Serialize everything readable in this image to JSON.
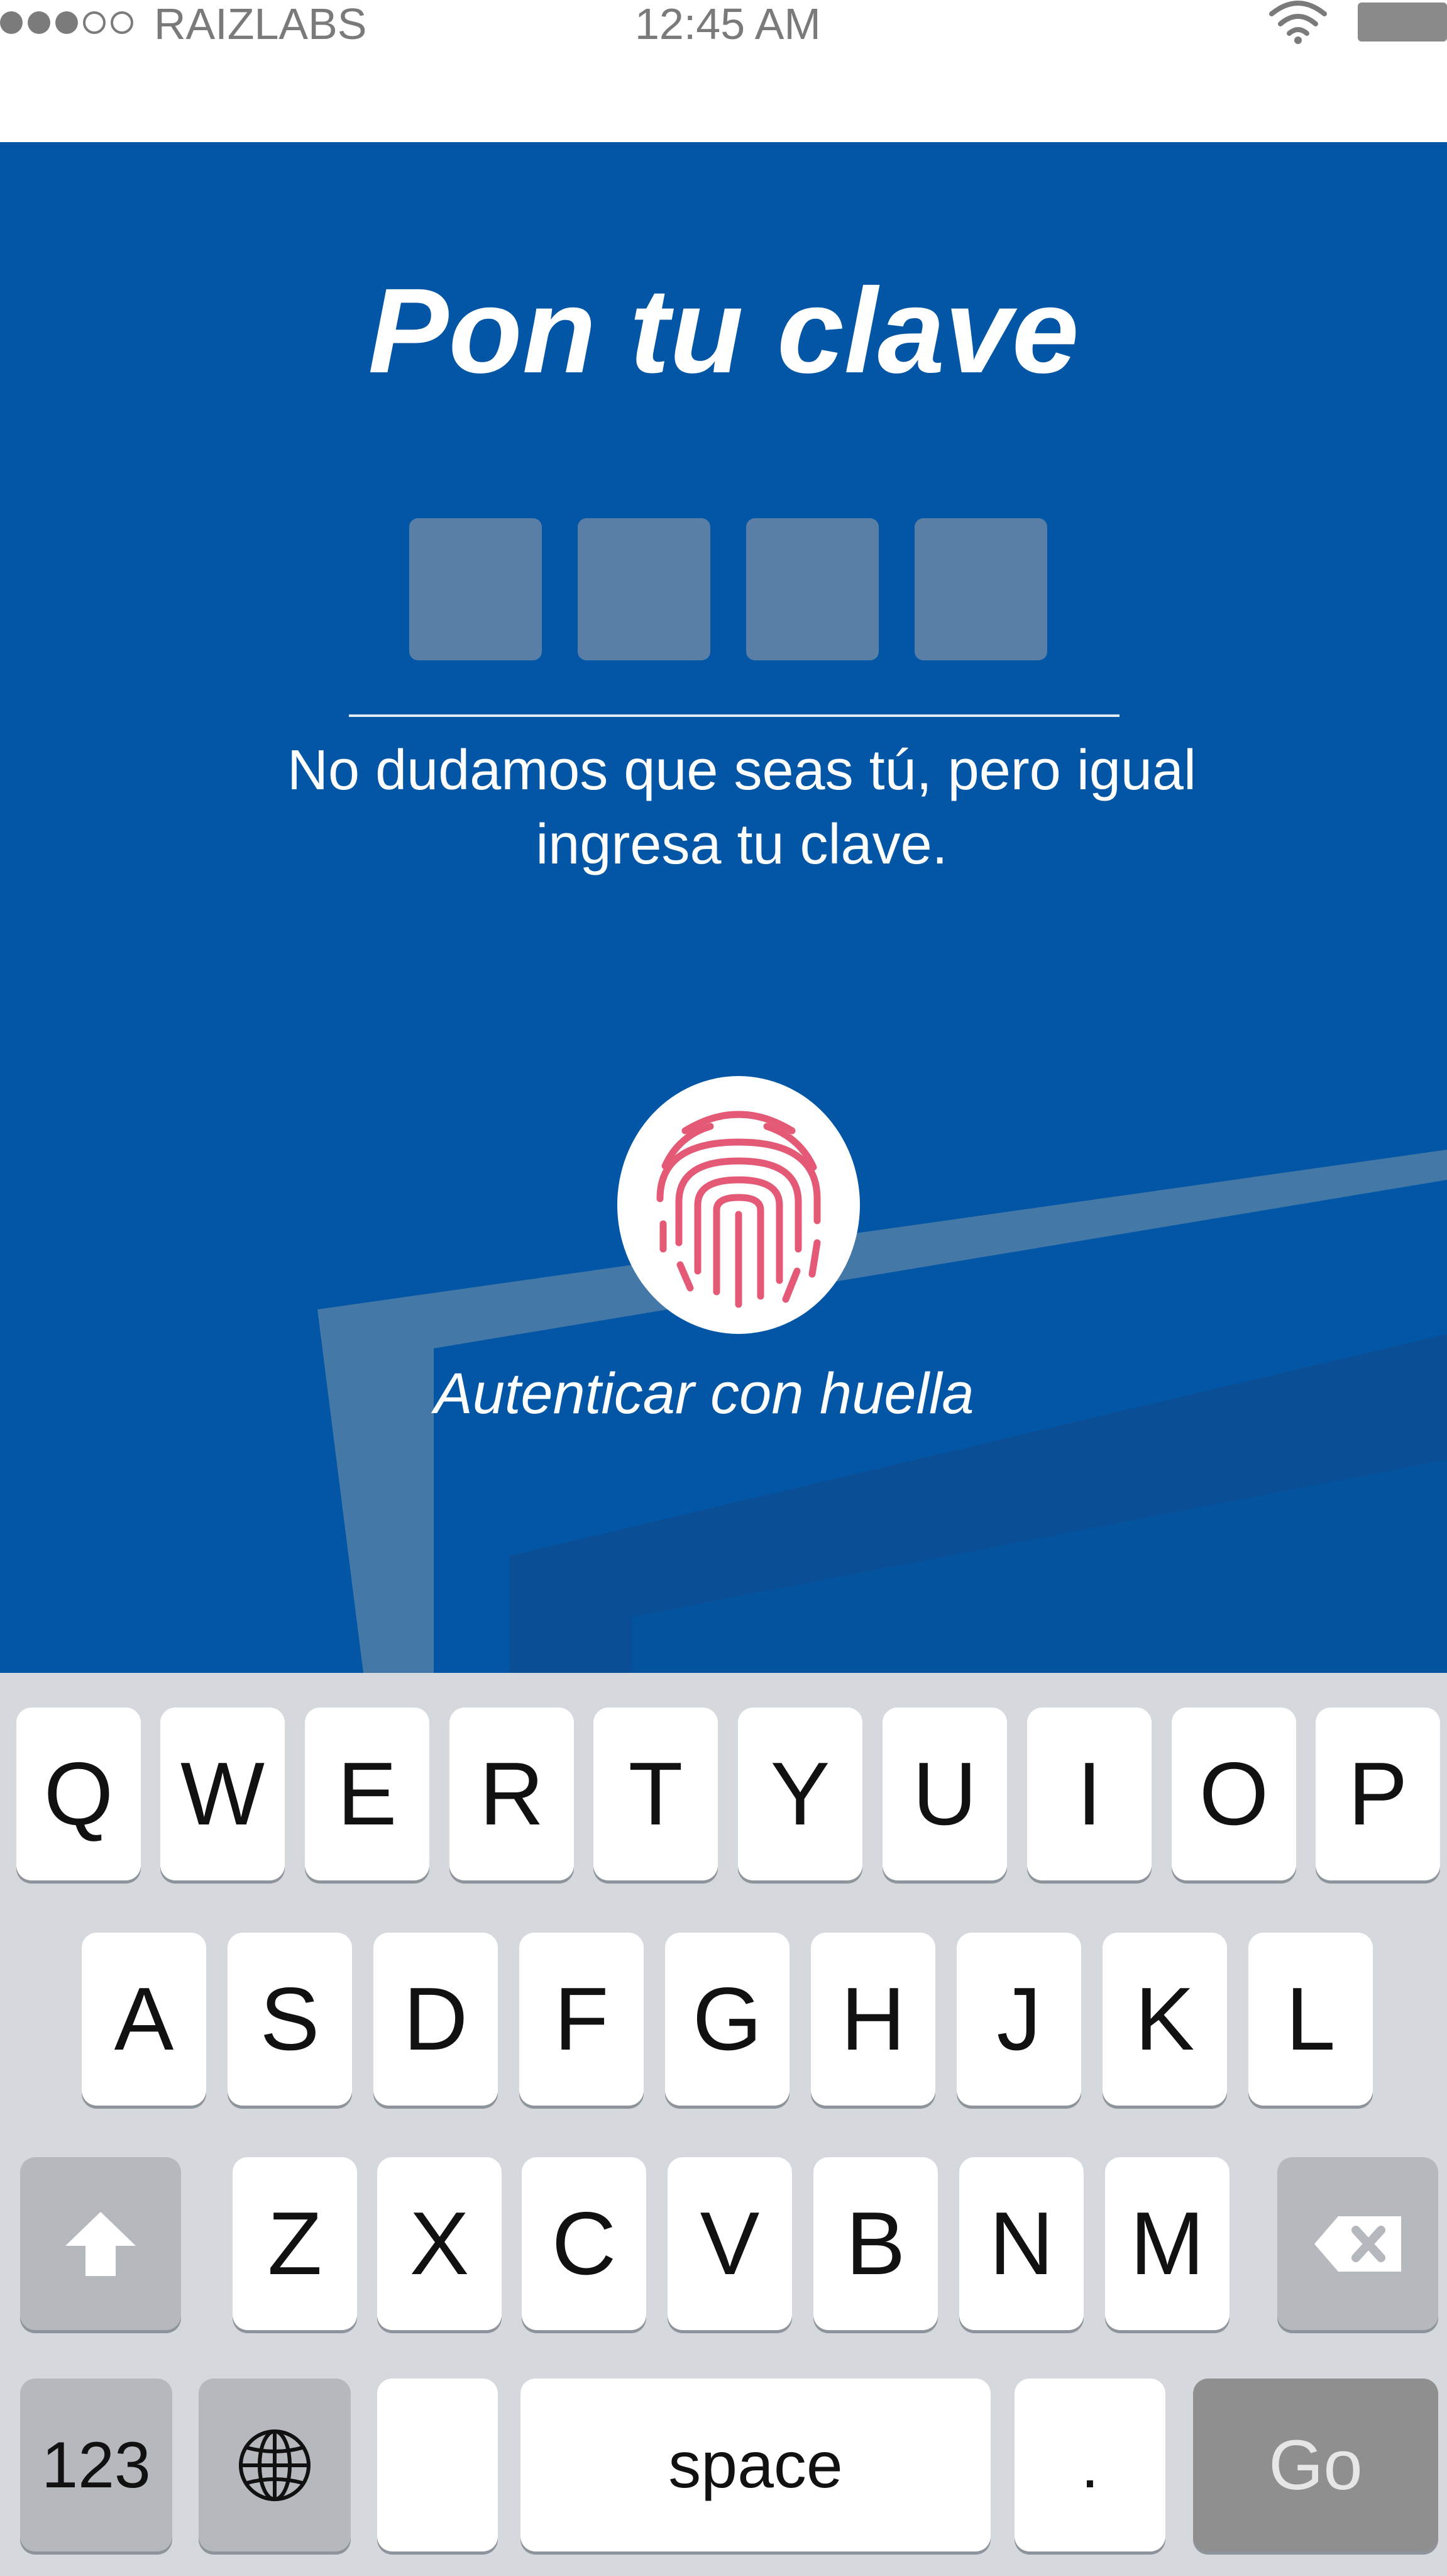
{
  "status_bar": {
    "carrier": "RAIZLABS",
    "time": "12:45 AM",
    "signal_dots": [
      "full",
      "full",
      "full",
      "empty",
      "empty"
    ],
    "wifi_icon": "wifi-icon",
    "battery_icon": "battery-icon"
  },
  "screen": {
    "title": "Pon tu clave",
    "pin_length": 4,
    "hint_line1": "No dudamos que seas tú, pero igual",
    "hint_line2": "ingresa tu clave.",
    "fingerprint_icon": "fingerprint-icon",
    "fingerprint_label": "Autenticar con huella"
  },
  "colors": {
    "background_blue": "#0256a5",
    "pin_box": "#5a7fa6",
    "fingerprint_red": "#e45a76",
    "keyboard_bg": "#d5d9de",
    "go_key": "#8f8f8f"
  },
  "keyboard": {
    "row1": [
      "Q",
      "W",
      "E",
      "R",
      "T",
      "Y",
      "U",
      "I",
      "O",
      "P"
    ],
    "row2": [
      "A",
      "S",
      "D",
      "F",
      "G",
      "H",
      "J",
      "K",
      "L"
    ],
    "row3": [
      "Z",
      "X",
      "C",
      "V",
      "B",
      "N",
      "M"
    ],
    "shift_icon": "shift-icon",
    "backspace_icon": "backspace-icon",
    "numbers_label": "123",
    "globe_icon": "globe-icon",
    "space_label": "space",
    "period_label": ".",
    "go_label": "Go"
  }
}
